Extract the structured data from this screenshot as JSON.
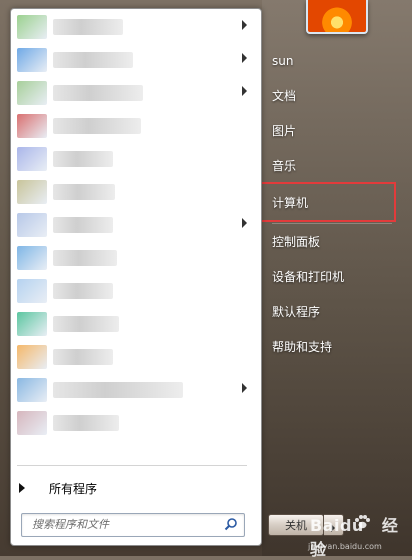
{
  "start_menu": {
    "user_name": "sun",
    "right_items": [
      {
        "label": "sun"
      },
      {
        "label": "文档"
      },
      {
        "label": "图片"
      },
      {
        "label": "音乐"
      },
      {
        "label": "计算机"
      },
      {
        "label": "控制面板"
      },
      {
        "label": "设备和打印机"
      },
      {
        "label": "默认程序"
      },
      {
        "label": "帮助和支持"
      }
    ],
    "highlighted_item": "计算机",
    "highlight_color": "#e23b3b",
    "all_programs_label": "所有程序",
    "search_placeholder": "搜索程序和文件",
    "shutdown_label": "关机"
  },
  "program_list": {
    "rows": [
      {
        "icon_color": "#9bd18f",
        "has_submenu": true
      },
      {
        "icon_color": "#6fa9e6",
        "has_submenu": true
      },
      {
        "icon_color": "#a7cf9a",
        "has_submenu": true
      },
      {
        "icon_color": "#d97070",
        "has_submenu": false
      },
      {
        "icon_color": "#aab6ea",
        "has_submenu": false
      },
      {
        "icon_color": "#c8c49a",
        "has_submenu": false
      },
      {
        "icon_color": "#b7c8e8",
        "has_submenu": true
      },
      {
        "icon_color": "#7fb6e6",
        "has_submenu": false
      },
      {
        "icon_color": "#b5d2f0",
        "has_submenu": false
      },
      {
        "icon_color": "#5bc6a0",
        "has_submenu": false
      },
      {
        "icon_color": "#f5b86a",
        "has_submenu": false
      },
      {
        "icon_color": "#8ab8e2",
        "has_submenu": true
      },
      {
        "icon_color": "#d6b6bd",
        "has_submenu": false
      }
    ]
  },
  "watermark": {
    "logo_text": "Baidu",
    "logo_suffix": "经验",
    "url": "jingyan.baidu.com"
  }
}
